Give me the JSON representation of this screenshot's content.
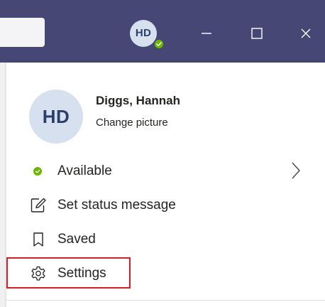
{
  "titlebar": {
    "avatar_initials": "HD",
    "presence_color": "#6bb700",
    "minimize_icon": "minimize-icon",
    "maximize_icon": "maximize-icon",
    "close_icon": "close-icon"
  },
  "profile": {
    "initials": "HD",
    "name": "Diggs, Hannah",
    "change_picture": "Change picture"
  },
  "menu": {
    "status_label": "Available",
    "status_color": "#6bb700",
    "status_message_label": "Set status message",
    "saved_label": "Saved",
    "settings_label": "Settings"
  },
  "colors": {
    "titlebar_bg": "#464775",
    "highlight_border": "#d61f2c"
  }
}
